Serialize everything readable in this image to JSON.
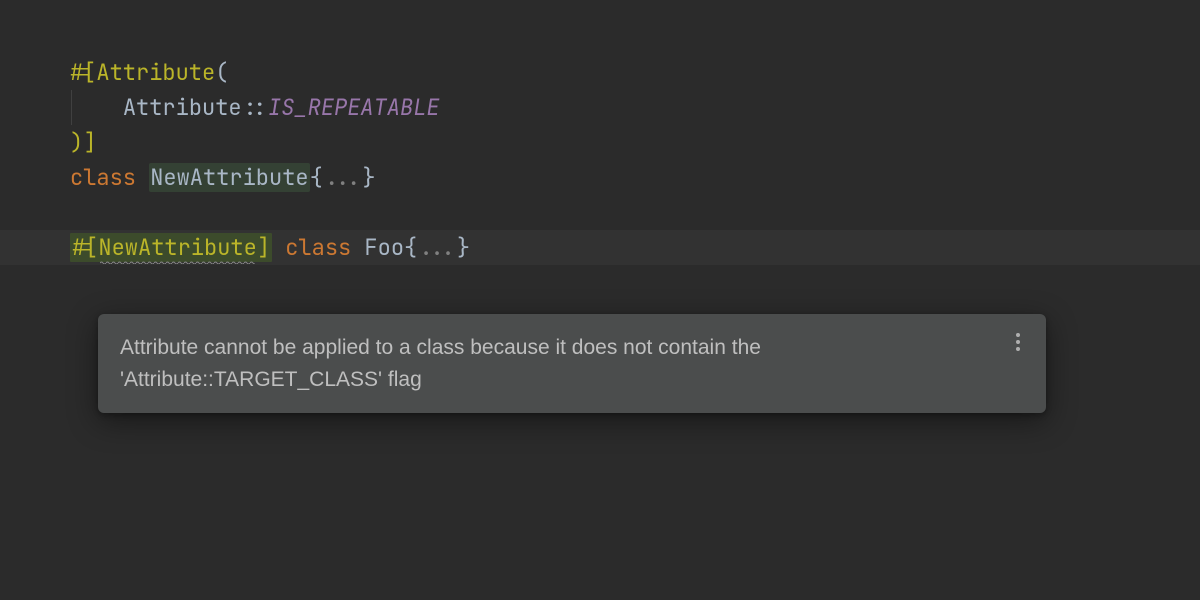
{
  "code": {
    "l1": {
      "hash_open": "#[",
      "attr_class": "Attribute",
      "paren_open": "("
    },
    "l2": {
      "indent": "    ",
      "qualifier": "Attribute",
      "scope": "::",
      "const": "IS_REPEATABLE"
    },
    "l3": {
      "close": ")]"
    },
    "l4": {
      "kw_class": "class ",
      "name": "NewAttribute",
      "brace_open": "{",
      "fold": "...",
      "brace_close": "}"
    },
    "l6": {
      "hash_open": "#[",
      "attr": "NewAttribute",
      "hash_close": "]",
      "space": " ",
      "kw_class": "class ",
      "name": "Foo",
      "brace_open": "{",
      "fold": "...",
      "brace_close": "}"
    }
  },
  "tooltip": {
    "message": "Attribute cannot be applied to a class because it does not contain the 'Attribute::TARGET_CLASS' flag"
  }
}
